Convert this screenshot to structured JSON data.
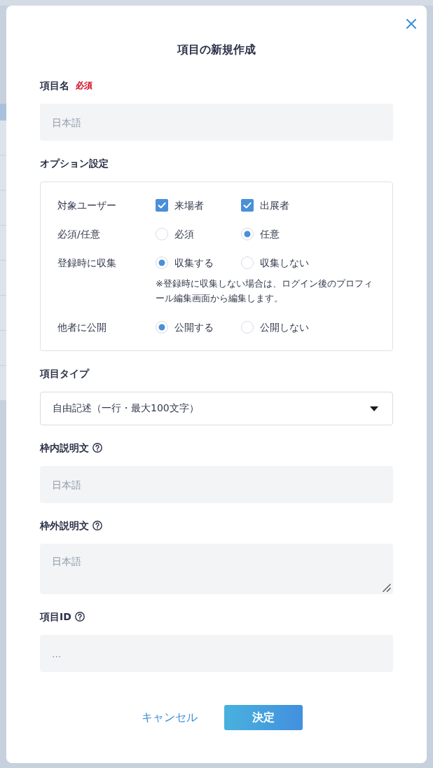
{
  "dialog": {
    "title": "項目の新規作成"
  },
  "sections": [
    {
      "kind": "input",
      "label": "項目名",
      "required_badge": "必須",
      "placeholder": "日本語"
    },
    {
      "kind": "options",
      "label": "オプション設定",
      "rows": [
        {
          "label": "対象ユーザー",
          "kind": "checkbox",
          "choices": [
            {
              "label": "来場者",
              "checked": true
            },
            {
              "label": "出展者",
              "checked": true
            }
          ]
        },
        {
          "label": "必須/任意",
          "kind": "radio",
          "choices": [
            {
              "label": "必須",
              "selected": false
            },
            {
              "label": "任意",
              "selected": true
            }
          ]
        },
        {
          "label": "登録時に収集",
          "kind": "radio",
          "choices": [
            {
              "label": "収集する",
              "selected": true
            },
            {
              "label": "収集しない",
              "selected": false
            }
          ],
          "note": "※登録時に収集しない場合は、ログイン後のプロフィール編集画面から編集します。"
        },
        {
          "label": "他者に公開",
          "kind": "radio",
          "choices": [
            {
              "label": "公開する",
              "selected": true
            },
            {
              "label": "公開しない",
              "selected": false
            }
          ]
        }
      ]
    },
    {
      "kind": "select",
      "label": "項目タイプ",
      "value": "自由記述（一行・最大100文字）"
    },
    {
      "kind": "input",
      "label": "枠内説明文",
      "help": true,
      "placeholder": "日本語"
    },
    {
      "kind": "textarea",
      "label": "枠外説明文",
      "help": true,
      "placeholder": "日本語"
    },
    {
      "kind": "input",
      "label": "項目ID",
      "help": true,
      "placeholder": "..."
    }
  ],
  "buttons": [
    {
      "label": "キャンセル",
      "kind": "link"
    },
    {
      "label": "決定",
      "kind": "primary"
    }
  ]
}
